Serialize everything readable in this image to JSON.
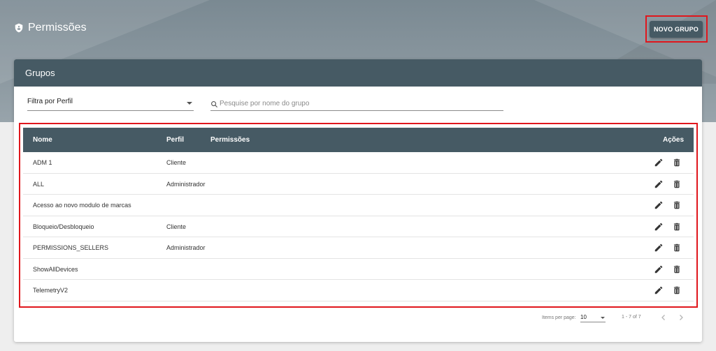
{
  "header": {
    "title": "Permissões",
    "new_group_label": "NOVO GRUPO"
  },
  "card": {
    "title": "Grupos",
    "filter_label": "Filtra por Perfil",
    "search_placeholder": "Pesquise por nome do grupo"
  },
  "table": {
    "columns": {
      "name": "Nome",
      "perfil": "Perfil",
      "permissions": "Permissões",
      "actions": "Ações"
    },
    "rows": [
      {
        "name": "ADM 1",
        "perfil": "Cliente"
      },
      {
        "name": "ALL",
        "perfil": "Administrador"
      },
      {
        "name": "Acesso ao novo modulo de marcas",
        "perfil": ""
      },
      {
        "name": "Bloqueio/Desbloqueio",
        "perfil": "Cliente"
      },
      {
        "name": "PERMISSIONS_SELLERS",
        "perfil": "Administrador"
      },
      {
        "name": "ShowAllDevices",
        "perfil": ""
      },
      {
        "name": "TelemetryV2",
        "perfil": ""
      }
    ]
  },
  "paginator": {
    "items_per_page_label": "Items per page:",
    "items_per_page_value": "10",
    "range_label": "1 - 7 of 7"
  },
  "colors": {
    "header_dark": "#465a64",
    "highlight_red": "#e0161c"
  }
}
